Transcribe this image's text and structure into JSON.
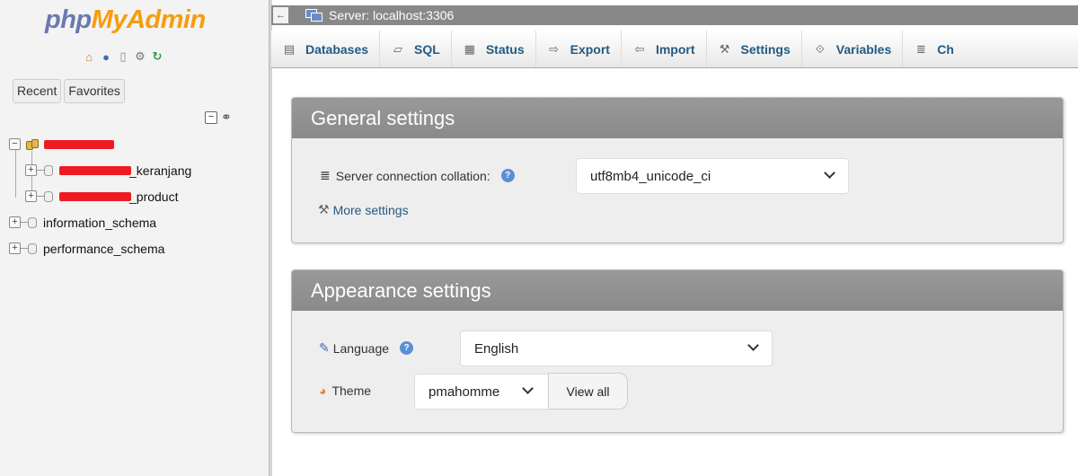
{
  "app": {
    "logo_php": "php",
    "logo_myadmin": "MyAdmin"
  },
  "sidebar": {
    "tabs": [
      "Recent",
      "Favorites"
    ],
    "tree": {
      "databases": [
        {
          "label": "",
          "redacted": true,
          "children": [
            {
              "label": "_keranjang",
              "redacted": true
            },
            {
              "label": "_product",
              "redacted": true
            }
          ]
        },
        {
          "label": "information_schema"
        },
        {
          "label": "performance_schema"
        }
      ]
    },
    "tree_link_icon": "link-icon",
    "quick_link_icons": [
      "home-icon",
      "exit-icon",
      "docs-icon",
      "settings-icon",
      "reload-icon"
    ]
  },
  "header": {
    "server_title": "Server: localhost:3306",
    "collapse_glyph": "←"
  },
  "tabs": [
    {
      "label": "Databases",
      "icon": "database-icon"
    },
    {
      "label": "SQL",
      "icon": "sql-icon"
    },
    {
      "label": "Status",
      "icon": "status-icon"
    },
    {
      "label": "Export",
      "icon": "export-icon"
    },
    {
      "label": "Import",
      "icon": "import-icon"
    },
    {
      "label": "Settings",
      "icon": "wrench-icon"
    },
    {
      "label": "Variables",
      "icon": "variables-icon"
    },
    {
      "label": "Ch",
      "icon": "charsets-icon"
    }
  ],
  "general": {
    "title": "General settings",
    "collation_label": "Server connection collation:",
    "collation_value": "utf8mb4_unicode_ci",
    "more_settings": "More settings"
  },
  "appearance": {
    "title": "Appearance settings",
    "language_label": "Language",
    "language_value": "English",
    "theme_label": "Theme",
    "theme_value": "pmahomme",
    "view_all": "View all"
  },
  "colors": {
    "link": "#235a81",
    "panel_header": "#8f8f8f",
    "logo_php": "#6c78af",
    "logo_myadmin": "#f89c0e",
    "redaction": "#ee1b24"
  }
}
